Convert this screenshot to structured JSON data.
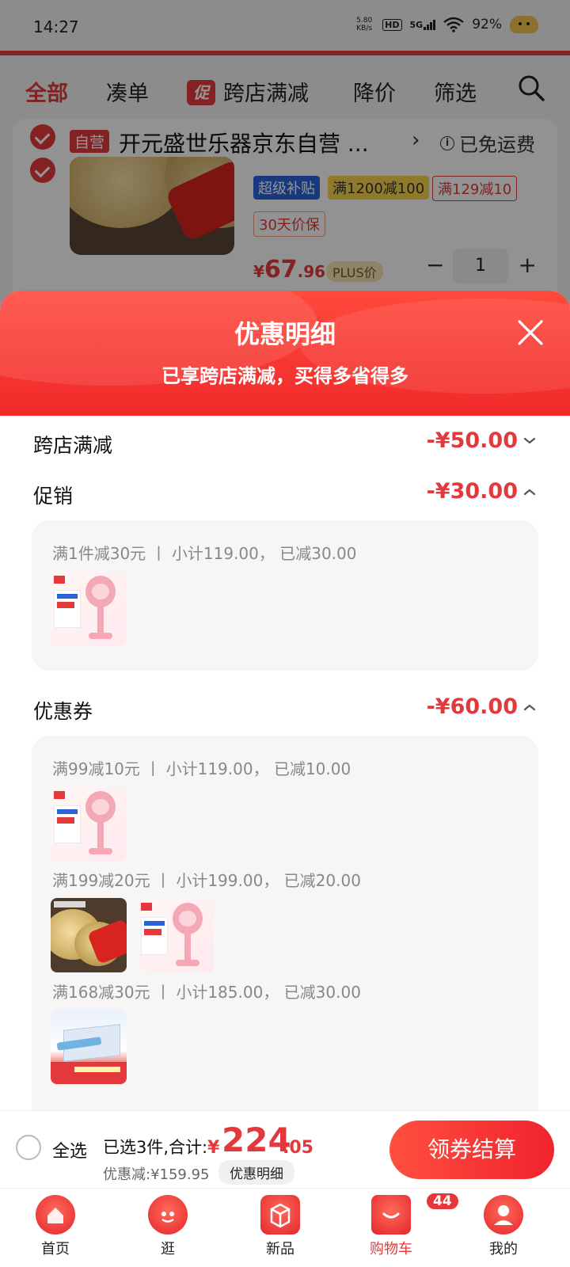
{
  "status_bar": {
    "time": "14:27",
    "net_speed_value": "5.80",
    "net_speed_unit": "KB/s",
    "hd": "HD",
    "network": "5G",
    "battery": "92%"
  },
  "top_tabs": {
    "all": "全部",
    "bundle": "凑单",
    "promo_badge": "促",
    "cross_store": "跨店满减",
    "price_drop": "降价",
    "filter": "筛选"
  },
  "shop": {
    "self_tag": "自营",
    "name": "开元盛世乐器京东自营 ...",
    "arrow": "›",
    "free_shipping": "已免运费",
    "info_icon": "i"
  },
  "product": {
    "tag_super_subsidy": "超级补贴",
    "tag_subsidy_rule": "满1200减100",
    "tag_manjian": "满129减10",
    "tag_price_protect": "30天价保",
    "price_symbol": "¥",
    "price_int": "67",
    "price_dec": ".96",
    "plus_label": "PLUS价",
    "qty_minus": "−",
    "qty": "1",
    "qty_plus": "+"
  },
  "sheet": {
    "title": "优惠明细",
    "subtitle": "已享跨店满减，买得多省得多",
    "sections": {
      "cross_store": {
        "label": "跨店满减",
        "amount": "-¥50.00"
      },
      "promotion": {
        "label": "促销",
        "amount": "-¥30.00",
        "rules": [
          {
            "text": "满1件减30元 丨 小计119.00， 已减30.00"
          }
        ]
      },
      "coupon": {
        "label": "优惠券",
        "amount": "-¥60.00",
        "rules": [
          {
            "text": "满99减10元 丨 小计119.00， 已减10.00"
          },
          {
            "text": "满199减20元 丨 小计199.00， 已减20.00"
          },
          {
            "text": "满168减30元 丨 小计185.00， 已减30.00"
          }
        ]
      }
    }
  },
  "checkout": {
    "select_all": "全选",
    "selected_text": "已选3件,合计:",
    "total_symbol": "¥",
    "total_int": "224",
    "total_dec": ".05",
    "discount_text": "优惠减:¥159.95",
    "detail_button": "优惠明细",
    "pay_button": "领券结算"
  },
  "tab_bar": {
    "home": "首页",
    "browse": "逛",
    "new": "新品",
    "cart": "购物车",
    "cart_badge": "44",
    "mine": "我的"
  },
  "colors": {
    "accent": "#e4393c",
    "header_gradient_top": "#ff4a3d",
    "header_gradient_bottom": "#f02a2a"
  }
}
